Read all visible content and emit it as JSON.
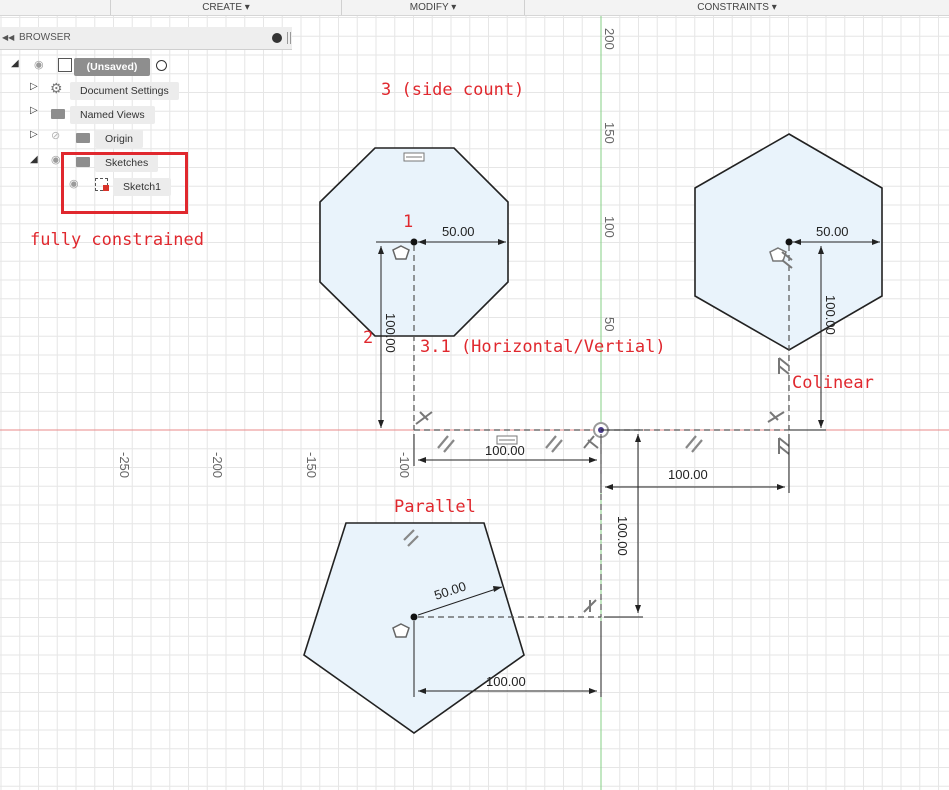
{
  "toolbar": {
    "create_label": "CREATE ▾",
    "modify_label": "MODIFY ▾",
    "constraints_label": "CONSTRAINTS ▾"
  },
  "browser": {
    "header_label": "BROWSER",
    "root_label": "(Unsaved)",
    "items": [
      {
        "label": "Document Settings"
      },
      {
        "label": "Named Views"
      },
      {
        "label": "Origin"
      },
      {
        "label": "Sketches"
      },
      {
        "label": "Sketch1"
      }
    ]
  },
  "annotations": {
    "side_count": "3 (side count)",
    "fully_constrained": "fully constrained",
    "point1": "1",
    "point2": "2",
    "horizontal_vertical": "3.1 (Horizontal/Vertial)",
    "colinear": "Colinear",
    "parallel": "Parallel"
  },
  "axis": {
    "x_ticks": [
      "-250",
      "-200",
      "-150",
      "-100"
    ],
    "y_ticks": [
      "200",
      "150",
      "100",
      "50"
    ]
  },
  "dimensions": {
    "octagon_radius": "50.00",
    "octagon_height": "100.00",
    "octagon_offset": "100.00",
    "hexagon_radius": "50.00",
    "hexagon_height": "100.00",
    "hexagon_offset": "100.00",
    "pentagon_radius": "50.00",
    "pentagon_offset": "100.00",
    "pentagon_depth": "100.00"
  },
  "colors": {
    "annotation_red": "#e0282e",
    "shape_fill": "#e9f3fb",
    "grid_line": "#e3e3e3",
    "x_axis": "#e88a8a",
    "y_axis": "#86cf86"
  }
}
